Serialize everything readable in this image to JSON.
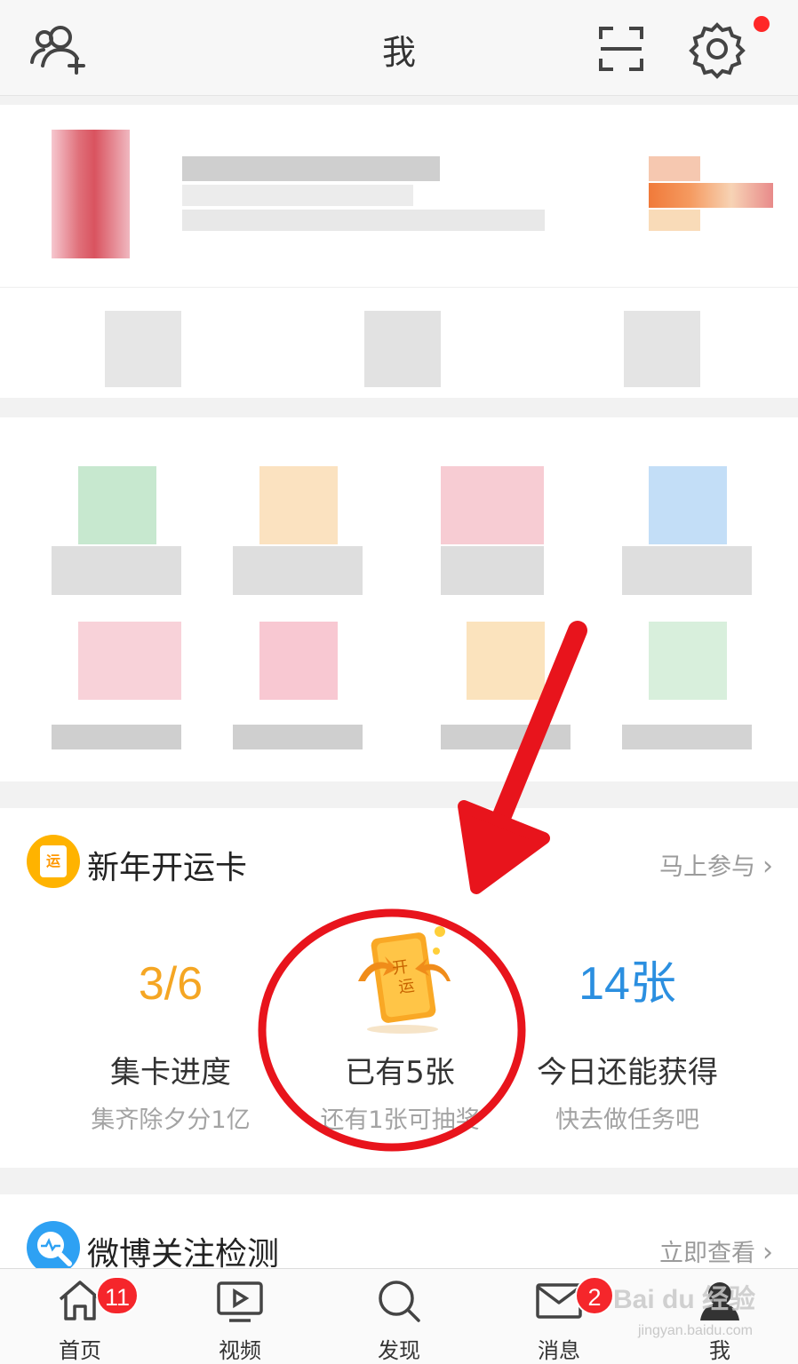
{
  "header": {
    "title": "我",
    "icons": [
      "add-friend-icon",
      "scan-icon",
      "settings-icon"
    ],
    "settings_has_dot": true
  },
  "kaiyun_section": {
    "title": "新年开运卡",
    "link_label": "马上参与",
    "icon_glyph": "运",
    "card_image_text": "开运",
    "stats": {
      "progress": {
        "value": "3/6",
        "label": "集卡进度",
        "sub": "集齐除夕分1亿",
        "color": "#f5a623"
      },
      "owned": {
        "label": "已有5张",
        "sub": "还有1张可抽奖"
      },
      "today": {
        "value": "14张",
        "label": "今日还能获得",
        "sub": "快去做任务吧",
        "color": "#2b8fe0"
      }
    }
  },
  "weibo_section": {
    "title": "微博关注检测",
    "link_label": "立即查看"
  },
  "tabbar": {
    "tabs": [
      {
        "label": "首页",
        "icon": "home-icon",
        "badge": "11"
      },
      {
        "label": "视频",
        "icon": "video-icon",
        "badge": ""
      },
      {
        "label": "发现",
        "icon": "search-icon",
        "badge": ""
      },
      {
        "label": "消息",
        "icon": "mail-icon",
        "badge": "2"
      },
      {
        "label": "我",
        "icon": "profile-icon",
        "badge": ""
      }
    ]
  },
  "watermark": {
    "text": "Bai du 经验",
    "sub": "jingyan.baidu.com"
  },
  "colors": {
    "accent_orange": "#f5a623",
    "accent_blue": "#2b8fe0",
    "annotation_red": "#e8141c",
    "badge_red": "#f5262b"
  }
}
